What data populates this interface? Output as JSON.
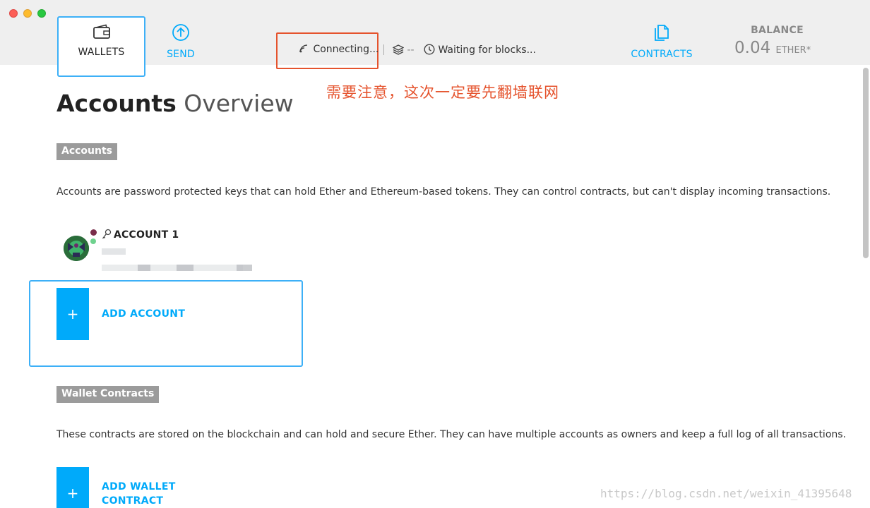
{
  "window": {
    "traffic_lights": [
      "close",
      "minimize",
      "maximize"
    ]
  },
  "nav": {
    "wallets": {
      "label": "WALLETS",
      "icon": "wallet-icon"
    },
    "send": {
      "label": "SEND",
      "icon": "arrow-up-circle-icon"
    },
    "contracts": {
      "label": "CONTRACTS",
      "icon": "documents-icon"
    }
  },
  "status": {
    "connecting": "Connecting...",
    "block_count": "--",
    "waiting": "Waiting for blocks..."
  },
  "balance": {
    "label": "BALANCE",
    "value": "0.04",
    "unit": "ETHER*"
  },
  "annotation": "需要注意，这次一定要先翻墙联网",
  "page": {
    "title_strong": "Accounts",
    "title_light": "Overview"
  },
  "accounts_section": {
    "tag": "Accounts",
    "description": "Accounts are password protected keys that can hold Ether and Ethereum-based tokens. They can control contracts, but can't display incoming transactions.",
    "items": [
      {
        "name": "ACCOUNT 1"
      }
    ],
    "add_label": "ADD ACCOUNT",
    "add_plus": "+"
  },
  "wallet_contracts_section": {
    "tag": "Wallet Contracts",
    "description": "These contracts are stored on the blockchain and can hold and secure Ether. They can have multiple accounts as owners and keep a full log of all transactions.",
    "add_label_line1": "ADD WALLET",
    "add_label_line2": "CONTRACT",
    "add_plus": "+"
  },
  "watermark": "https://blog.csdn.net/weixin_41395648",
  "colors": {
    "accent": "#00aafa",
    "highlight_box": "#3db0f7",
    "annotation_red": "#e5532d",
    "tag_gray": "#9b9b9b"
  }
}
